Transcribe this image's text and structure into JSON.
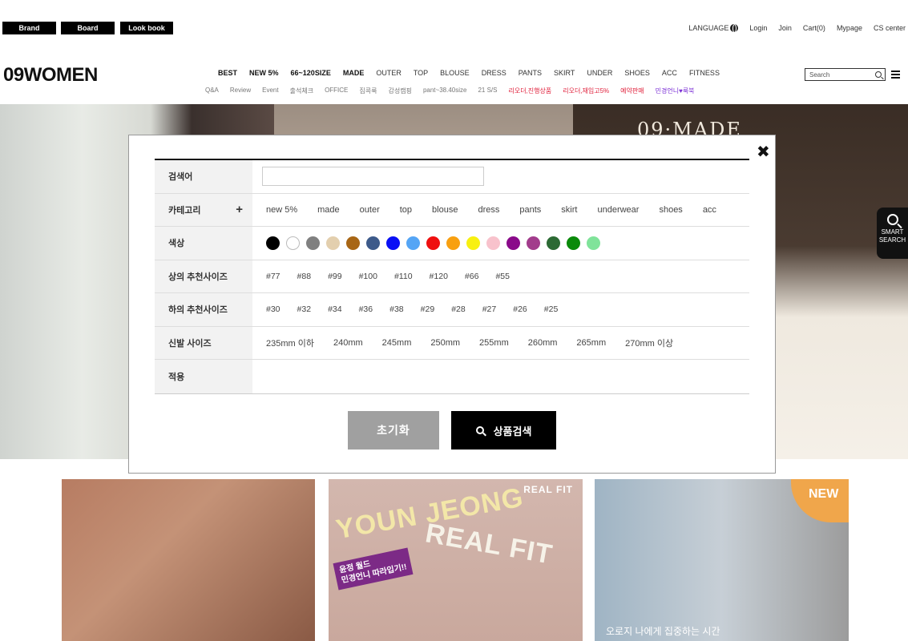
{
  "top_buttons": [
    "Brand",
    "Board",
    "Look book"
  ],
  "top_links": {
    "language": "LANGUAGE",
    "login": "Login",
    "join": "Join",
    "cart": "Cart(0)",
    "mypage": "Mypage",
    "cs": "CS center"
  },
  "logo": "09WOMEN",
  "main_nav": [
    "BEST",
    "NEW 5%",
    "66~120SIZE",
    "MADE",
    "OUTER",
    "TOP",
    "BLOUSE",
    "DRESS",
    "PANTS",
    "SKIRT",
    "UNDER",
    "SHOES",
    "ACC",
    "FITNESS"
  ],
  "sub_nav": [
    "Q&A",
    "Review",
    "Event",
    "출석체크",
    "OFFICE",
    "집콕룩",
    "감성캠핑",
    "pant~38.40size",
    "21 S/S",
    "리오더,진행상품",
    "리오더,재입고5%",
    "예약판매",
    "민경언니♥룩북"
  ],
  "search": {
    "placeholder": "Search"
  },
  "hero": {
    "made_title": "09·MADE"
  },
  "smart_search": {
    "label": "SMART SEARCH"
  },
  "filter": {
    "keyword_label": "검색어",
    "keyword_value": "",
    "category_label": "카테고리",
    "categories": [
      "new 5%",
      "made",
      "outer",
      "top",
      "blouse",
      "dress",
      "pants",
      "skirt",
      "underwear",
      "shoes",
      "acc"
    ],
    "color_label": "색상",
    "colors": [
      "#000000",
      "#ffffff",
      "#808080",
      "#e3cfae",
      "#a86615",
      "#3d5a8a",
      "#0a10f5",
      "#55a5f5",
      "#ef1010",
      "#f8a010",
      "#f8f010",
      "#f8c2cc",
      "#8a0a8a",
      "#a23c8c",
      "#2c6a34",
      "#0a8a0a",
      "#80e39a"
    ],
    "top_size_label": "상의 추천사이즈",
    "top_sizes": [
      "#77",
      "#88",
      "#99",
      "#100",
      "#110",
      "#120",
      "#66",
      "#55"
    ],
    "bottom_size_label": "하의 추천사이즈",
    "bottom_sizes": [
      "#30",
      "#32",
      "#34",
      "#36",
      "#38",
      "#29",
      "#28",
      "#27",
      "#26",
      "#25"
    ],
    "shoe_label": "신발 사이즈",
    "shoe_sizes": [
      "235mm 이하",
      "240mm",
      "245mm",
      "250mm",
      "255mm",
      "260mm",
      "265mm",
      "270mm 이상"
    ],
    "applied_label": "적용",
    "reset_button": "초기화",
    "search_button": "상품검색"
  },
  "banners": {
    "b2_tag": "REAL FIT",
    "b2_title1": "YOUN JEONG",
    "b2_title2": "REAL FIT",
    "b2_sticker": "윤정 월드\n민경언니 따라입기!!",
    "b3_badge": "NEW",
    "b3_caption": "오로지 나에게 집중하는 시간"
  }
}
